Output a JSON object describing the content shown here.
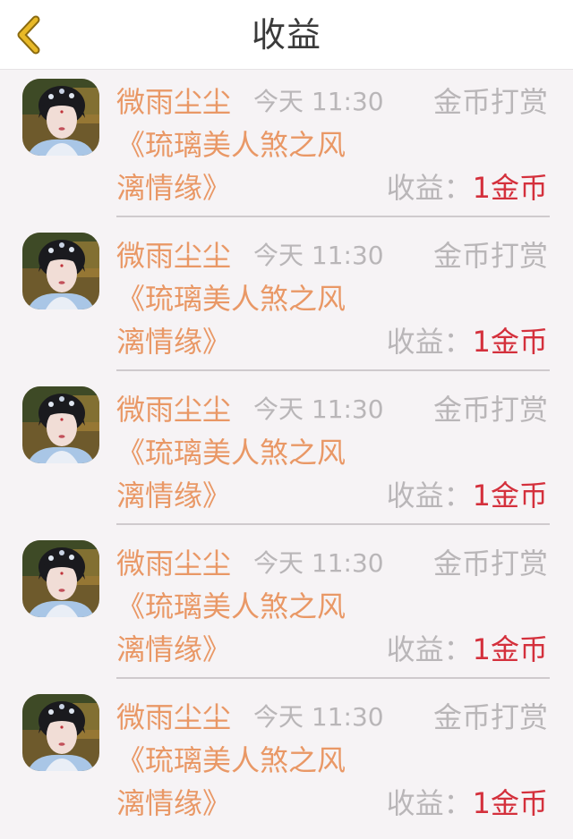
{
  "header": {
    "title": "收益",
    "back_icon": "chevron-left-icon"
  },
  "colors": {
    "accent_orange": "#e99866",
    "amount_red": "#d4303c",
    "muted_gray": "#b9b6b8",
    "back_icon_yellow": "#e8b927",
    "background": "#f6f3f5"
  },
  "records": [
    {
      "name": "微雨尘尘",
      "time": "今天 11:30",
      "type": "金币打赏",
      "book_line1": "《琉璃美人煞之风",
      "book_line2": "漓情缘》",
      "income_label": "收益：",
      "income_value": "1金币"
    },
    {
      "name": "微雨尘尘",
      "time": "今天 11:30",
      "type": "金币打赏",
      "book_line1": "《琉璃美人煞之风",
      "book_line2": "漓情缘》",
      "income_label": "收益：",
      "income_value": "1金币"
    },
    {
      "name": "微雨尘尘",
      "time": "今天 11:30",
      "type": "金币打赏",
      "book_line1": "《琉璃美人煞之风",
      "book_line2": "漓情缘》",
      "income_label": "收益：",
      "income_value": "1金币"
    },
    {
      "name": "微雨尘尘",
      "time": "今天 11:30",
      "type": "金币打赏",
      "book_line1": "《琉璃美人煞之风",
      "book_line2": "漓情缘》",
      "income_label": "收益：",
      "income_value": "1金币"
    },
    {
      "name": "微雨尘尘",
      "time": "今天 11:30",
      "type": "金币打赏",
      "book_line1": "《琉璃美人煞之风",
      "book_line2": "漓情缘》",
      "income_label": "收益：",
      "income_value": "1金币"
    }
  ]
}
